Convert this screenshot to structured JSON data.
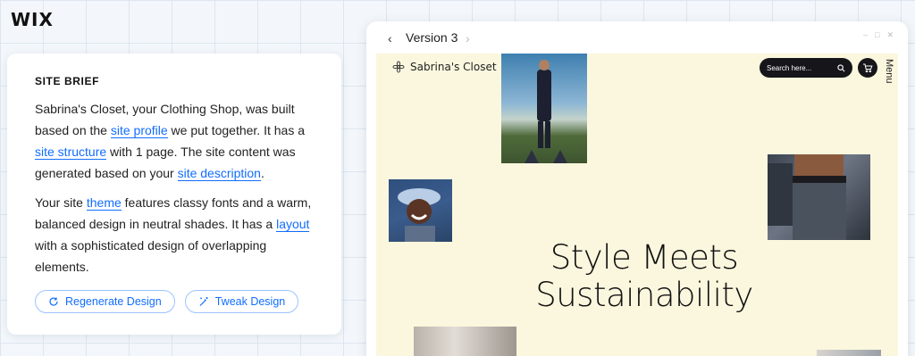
{
  "logo": "WIX",
  "brief": {
    "title": "SITE BRIEF",
    "p1": {
      "t1": "Sabrina's Closet, your Clothing Shop, was built based on the ",
      "l1": "site profile",
      "t2": " we put together. It has a ",
      "l2": "site structure",
      "t3": " with 1 page. The site content was generated based on your ",
      "l3": "site description",
      "t4": "."
    },
    "p2": {
      "t1": "Your site ",
      "l1": "theme",
      "t2": " features classy fonts and a warm, balanced design in neutral shades. It has a ",
      "l2": "layout",
      "t3": " with a sophisticated design of overlapping elements."
    },
    "buttons": {
      "regenerate": "Regenerate Design",
      "tweak": "Tweak Design"
    }
  },
  "preview": {
    "version": "Version 3",
    "site_name": "Sabrina's Closet",
    "search_placeholder": "Search here...",
    "menu": "Menu",
    "headline_1": "Style Meets",
    "headline_2": "Sustainability",
    "bg_color": "#fbf7de"
  },
  "accent": "#116dff"
}
